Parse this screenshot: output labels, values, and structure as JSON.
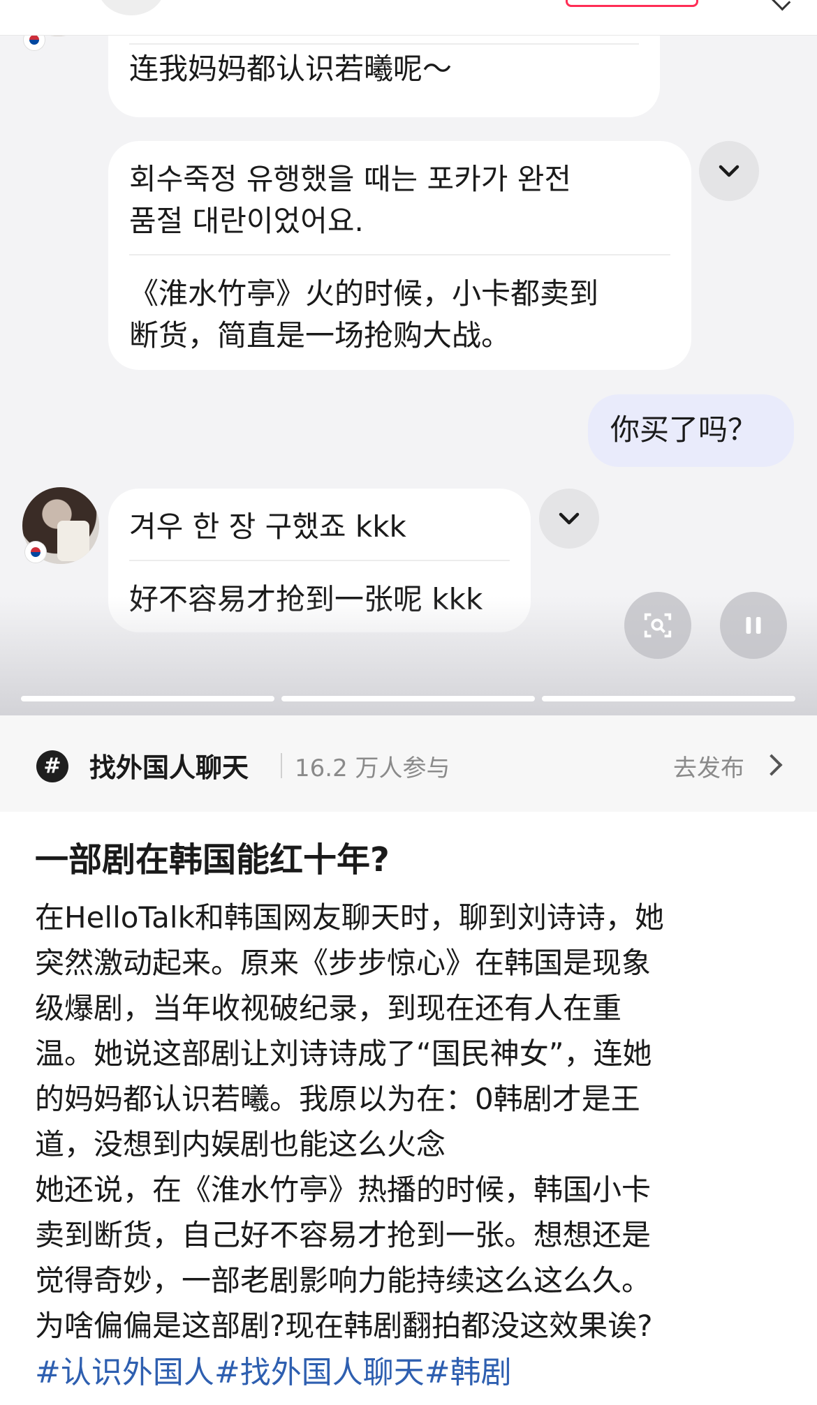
{
  "chat": {
    "msg1": {
      "line1": "连我妈妈都认识若曦呢～"
    },
    "msg2": {
      "korean_line1": "회수죽정 유행했을 때는 포카가 완전",
      "korean_line2": "품절 대란이었어요.",
      "chinese_line1": "《淮水竹亭》火的时候，小卡都卖到",
      "chinese_line2": "断货，简直是一场抢购大战。"
    },
    "msg3": {
      "text": "你买了吗？"
    },
    "msg4": {
      "korean": "겨우 한 장 구했죠 kkk",
      "chinese": "好不容易才抢到一张呢 kkk"
    }
  },
  "topic": {
    "icon": "hash-icon",
    "name": "找外国人聊天",
    "count": "16.2 万人参与",
    "publish": "去发布"
  },
  "post": {
    "title": "一部剧在韩国能红十年?",
    "lines": [
      "在HelloTalk和韩国网友聊天时，聊到刘诗诗，她",
      "突然激动起来。原来《步步惊心》在韩国是现象",
      "级爆剧，当年收视破纪录，到现在还有人在重",
      "温。她说这部剧让刘诗诗成了“国民神女”，连她",
      "的妈妈都认识若曦。我原以为在：0韩剧才是王",
      "道，没想到内娱剧也能这么火念",
      "她还说，在《淮水竹亭》热播的时候，韩国小卡",
      "卖到断货，自己好不容易才抢到一张。想想还是",
      "觉得奇妙，一部老剧影响力能持续这么这么久。",
      "为啥偏偏是这部剧?现在韩剧翻拍都没这效果诶?"
    ],
    "tags": "#认识外国人#找外国人聊天#韩剧"
  },
  "colors": {
    "tag": "#2e5fb0",
    "my_bubble": "#e9ebfb",
    "follow_border": "#ff2d55"
  }
}
